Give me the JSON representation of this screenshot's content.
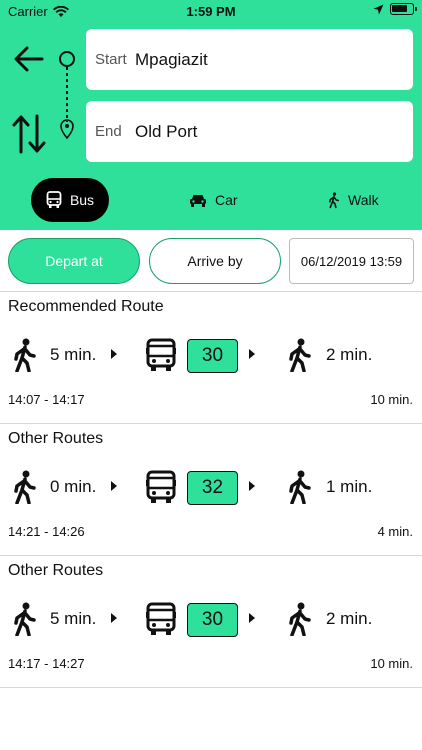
{
  "status_bar": {
    "carrier": "Carrier",
    "time": "1:59 PM"
  },
  "search": {
    "start_label": "Start",
    "start_value": "Mpagiazit",
    "end_label": "End",
    "end_value": "Old Port"
  },
  "modes": [
    {
      "label": "Bus",
      "icon": "bus-icon",
      "selected": true
    },
    {
      "label": "Car",
      "icon": "car-icon",
      "selected": false
    },
    {
      "label": "Walk",
      "icon": "walk-icon",
      "selected": false
    }
  ],
  "time_options": {
    "depart_label": "Depart at",
    "arrive_label": "Arrive by",
    "datetime": "06/12/2019 13:59",
    "selected": "depart"
  },
  "routes": [
    {
      "title": "Recommended Route",
      "walk_before": "5 min.",
      "line": "30",
      "walk_after": "2 min.",
      "time_range": "14:07 - 14:17",
      "duration": "10 min."
    },
    {
      "title": "Other Routes",
      "walk_before": "0 min.",
      "line": "32",
      "walk_after": "1 min.",
      "time_range": "14:21 - 14:26",
      "duration": "4 min."
    },
    {
      "title": "Other Routes",
      "walk_before": "5 min.",
      "line": "30",
      "walk_after": "2 min.",
      "time_range": "14:17 - 14:27",
      "duration": "10 min."
    }
  ],
  "colors": {
    "accent": "#2ee09a",
    "accent_border": "#1aa06b",
    "selected_mode_bg": "#000000"
  }
}
